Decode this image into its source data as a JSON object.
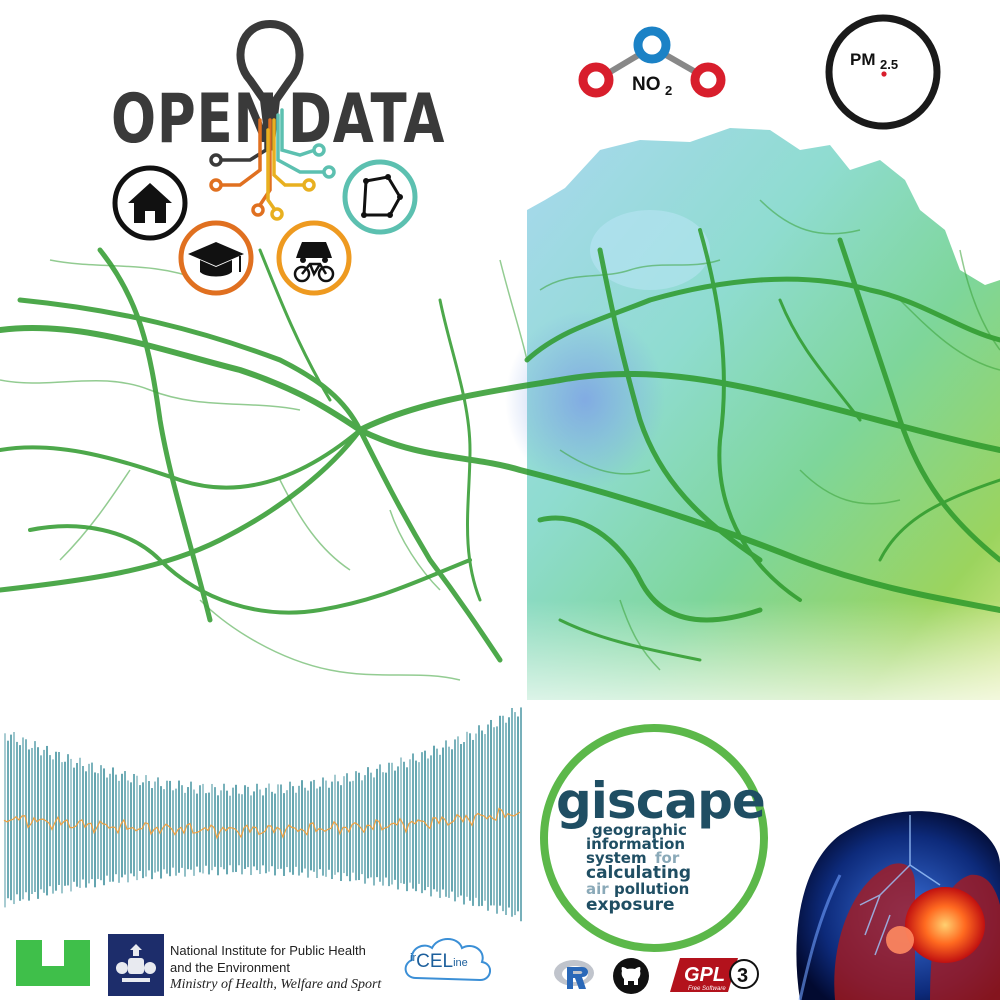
{
  "logo": {
    "open_text": "OPEN",
    "data_text": "DATA"
  },
  "pollutants": {
    "no2_main": "NO",
    "no2_sub": "2",
    "pm_main": "PM",
    "pm_sub": "2.5"
  },
  "giscape": {
    "title": "giscape",
    "words": [
      "geographic",
      "information",
      "system",
      "for",
      "calculating",
      "air",
      "pollution",
      "exposure"
    ]
  },
  "footer": {
    "institute_line1": "National Institute for Public Health",
    "institute_line2": "and the Environment",
    "ministry": "Ministry of Health, Welfare and Sport",
    "irceline_ir": "ir",
    "irceline_cel": "CEL",
    "irceline_ine": "ine",
    "gpl_text": "GPL",
    "gpl_version": "3",
    "gpl_free": "Free Software"
  },
  "colors": {
    "network_green": "#2e9a2c",
    "giscape_ring": "#5cb84a",
    "giscape_navy": "#1f4e63",
    "timeseries_teal": "#3d8f9c",
    "no2_red": "#d81e2c",
    "no2_blue": "#1b82c6",
    "icon_orange": "#e07020",
    "icon_amber": "#ee9a20",
    "icon_teal": "#5cc0b0"
  }
}
